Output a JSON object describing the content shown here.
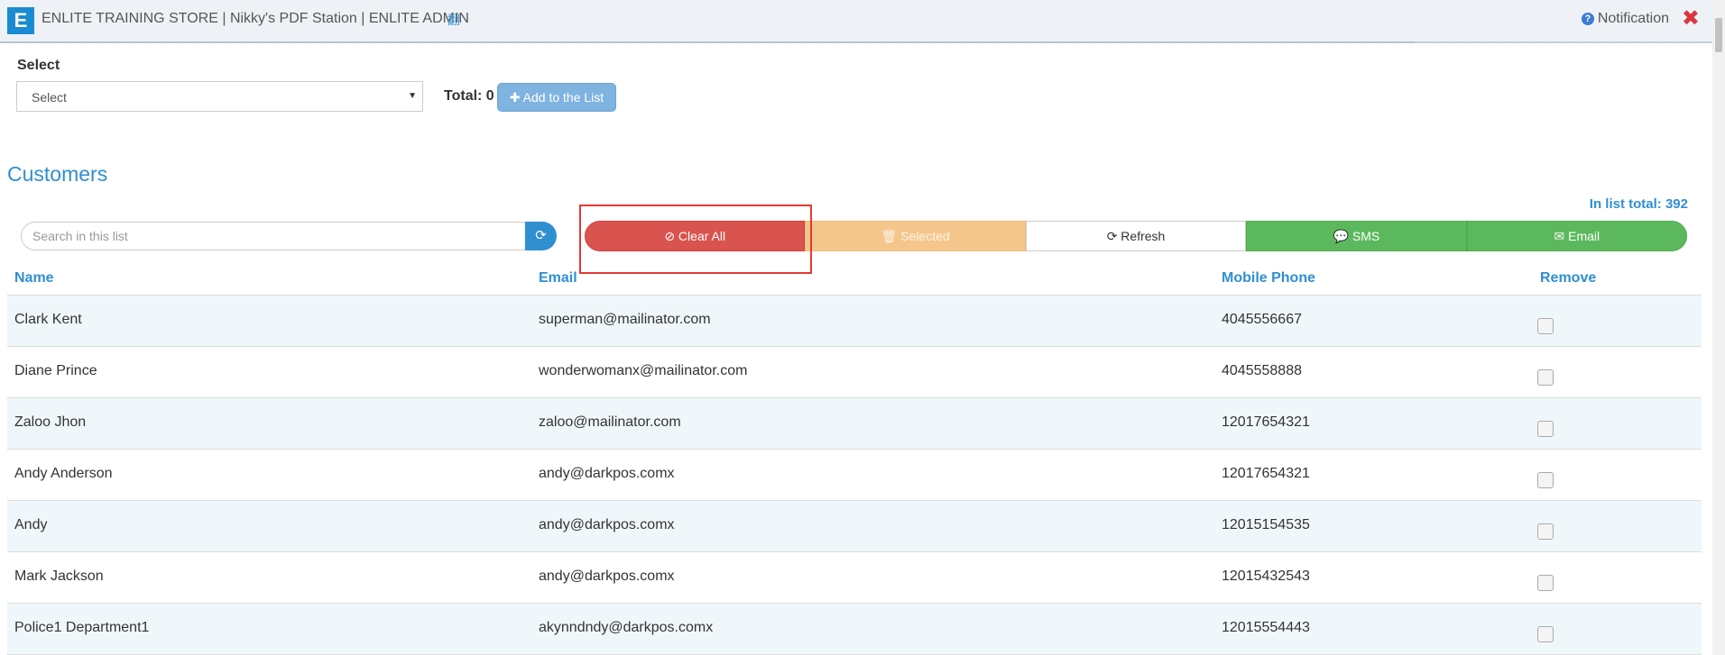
{
  "header": {
    "logo_letter": "E",
    "title": "ENLITE TRAINING STORE | Nikky's PDF Station | ENLITE ADMIN",
    "title_icon": "翻",
    "notification_label": "Notification",
    "notification_icon": "?",
    "close_icon": "✖"
  },
  "select_section": {
    "label": "Select",
    "value": "Select",
    "total_label": "Total: 0",
    "add_button_label": "✚ Add to the List"
  },
  "customers": {
    "title": "Customers",
    "list_total": "In list total: 392",
    "search_placeholder": "Search in this list",
    "search_icon": "⟳",
    "buttons": {
      "clear_all": "⊘ Clear All",
      "selected": "🗑 Selected",
      "refresh": "⟳ Refresh",
      "sms": "💬 SMS",
      "email": "✉ Email"
    },
    "columns": {
      "name": "Name",
      "email": "Email",
      "phone": "Mobile Phone",
      "remove": "Remove"
    },
    "rows": [
      {
        "name": "Clark Kent",
        "email": "superman@mailinator.com",
        "phone": "4045556667"
      },
      {
        "name": "Diane Prince",
        "email": "wonderwomanx@mailinator.com",
        "phone": "4045558888"
      },
      {
        "name": "Zaloo Jhon",
        "email": "zaloo@mailinator.com",
        "phone": "12017654321"
      },
      {
        "name": "Andy Anderson",
        "email": "andy@darkpos.comx",
        "phone": "12017654321"
      },
      {
        "name": "Andy",
        "email": "andy@darkpos.comx",
        "phone": "12015154535"
      },
      {
        "name": "Mark Jackson",
        "email": "andy@darkpos.comx",
        "phone": "12015432543"
      },
      {
        "name": "Police1 Department1",
        "email": "akynndndy@darkpos.comx",
        "phone": "12015554443"
      }
    ]
  },
  "colors": {
    "accent": "#2f8fd0",
    "danger": "#d9534f",
    "warning": "#f5c68b",
    "success": "#5cb85c",
    "highlight": "#e53935"
  }
}
